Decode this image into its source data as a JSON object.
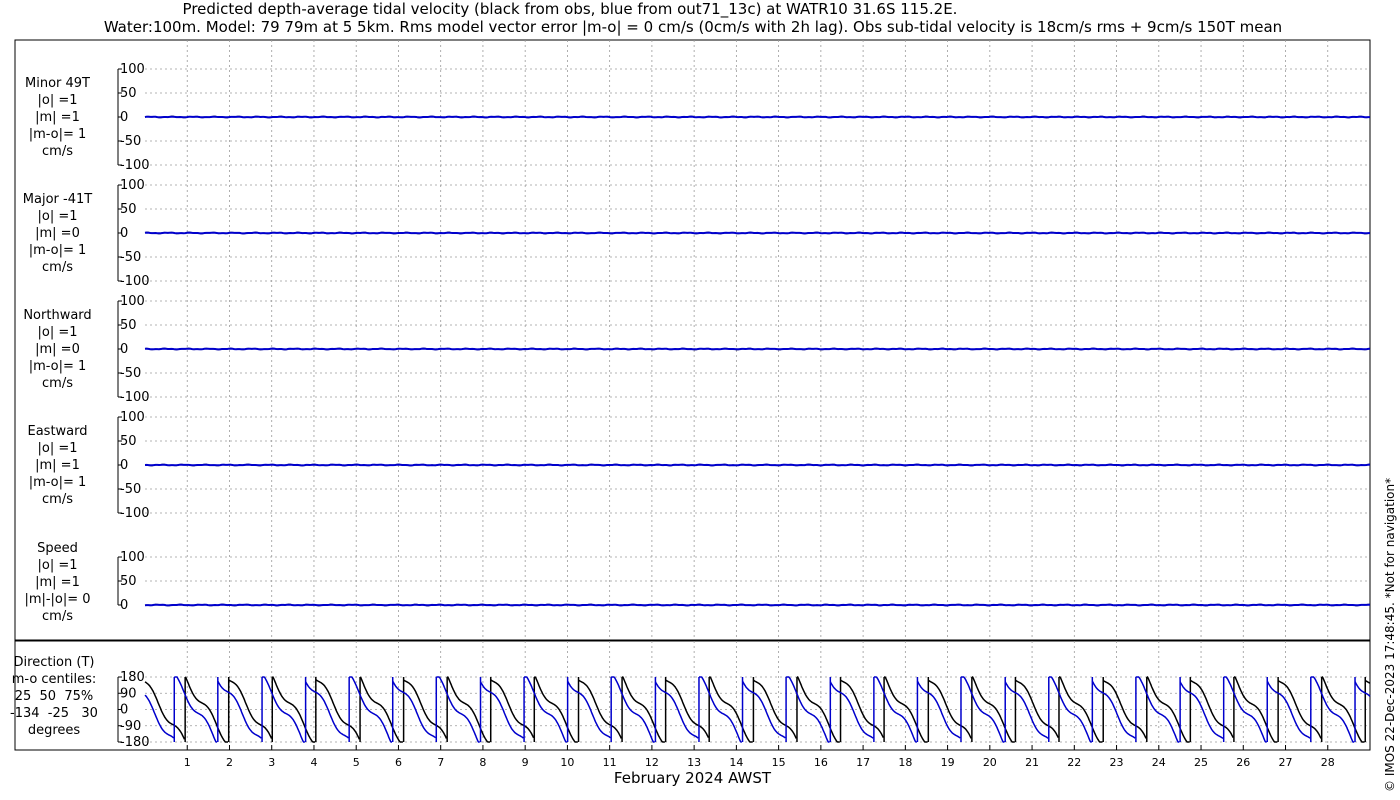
{
  "title_line1": "Predicted depth-average tidal velocity (black from obs, blue from out71_13c) at WATR10 31.6S 115.2E.",
  "title_line2": "Water:100m. Model: 79 79m at 5 5km. Rms model vector error |m-o| = 0 cm/s (0cm/s with 2h lag). Obs sub-tidal velocity is 18cm/s rms + 9cm/s 150T mean",
  "xaxis_label": "February 2024 AWST",
  "credit": "© IMOS 22-Dec-2023 17:48:45. *Not for navigation*",
  "colors": {
    "obs": "#000000",
    "model": "#0000cc",
    "grid": "#9a9a9a"
  },
  "chart_data": {
    "type": "line",
    "x_ticks": [
      1,
      2,
      3,
      4,
      5,
      6,
      7,
      8,
      9,
      10,
      11,
      12,
      13,
      14,
      15,
      16,
      17,
      18,
      19,
      20,
      21,
      22,
      23,
      24,
      25,
      26,
      27,
      28
    ],
    "x_range": [
      0,
      29
    ],
    "panels": [
      {
        "label": [
          "Minor 49T",
          "|o| =1",
          "|m| =1",
          "|m-o|= 1",
          "cm/s"
        ],
        "ylim": [
          -100,
          100
        ],
        "yticks": [
          100,
          50,
          0,
          -50,
          -100
        ],
        "series": [
          {
            "values_obs": "≈0",
            "values_model": "≈0"
          }
        ]
      },
      {
        "label": [
          "Major -41T",
          "|o| =1",
          "|m| =0",
          "|m-o|= 1",
          "cm/s"
        ],
        "ylim": [
          -100,
          100
        ],
        "yticks": [
          100,
          50,
          0,
          -50,
          -100
        ]
      },
      {
        "label": [
          "Northward",
          "|o| =1",
          "|m| =0",
          "|m-o|= 1",
          "cm/s"
        ],
        "ylim": [
          -100,
          100
        ],
        "yticks": [
          100,
          50,
          0,
          -50,
          -100
        ]
      },
      {
        "label": [
          "Eastward",
          "|o| =1",
          "|m| =1",
          "|m-o|= 1",
          "cm/s"
        ],
        "ylim": [
          -100,
          100
        ],
        "yticks": [
          100,
          50,
          0,
          -50,
          -100
        ]
      },
      {
        "label": [
          "Speed",
          "|o| =1",
          "|m| =1",
          "|m|-|o|= 0",
          "cm/s"
        ],
        "ylim": [
          0,
          100
        ],
        "yticks": [
          100,
          50,
          0
        ]
      },
      {
        "label": [
          "Direction (T)",
          "m-o centiles:",
          "25  50  75%",
          "-134  -25   30",
          "degrees"
        ],
        "ylim": [
          -180,
          180
        ],
        "yticks": [
          180,
          90,
          0,
          -90,
          -180
        ]
      }
    ]
  }
}
